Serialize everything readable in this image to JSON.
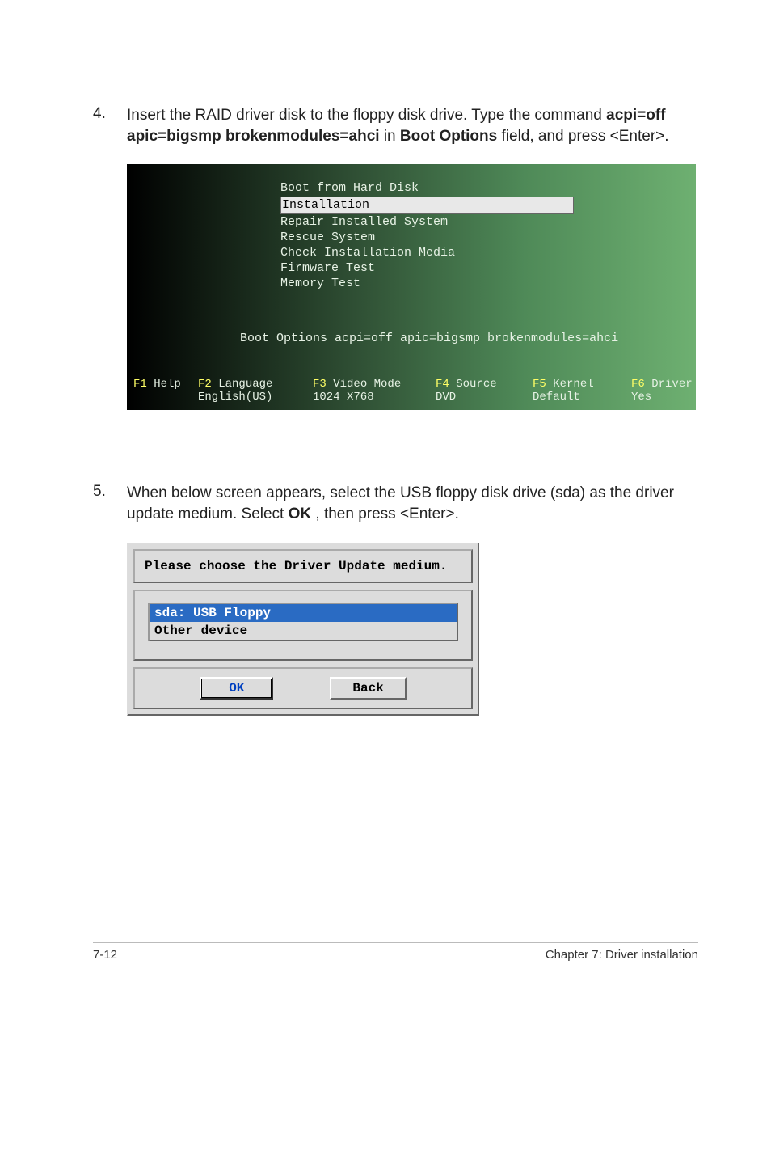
{
  "step4": {
    "num": "4.",
    "text_pre": "Insert the RAID driver disk to the floppy disk drive. Type the command ",
    "cmd": "acpi=off apic=bigsmp brokenmodules=ahci",
    "text_mid": " in ",
    "field": "Boot Options",
    "text_post": " field, and press <Enter>."
  },
  "boot": {
    "menu": [
      "Boot from Hard Disk",
      "Installation",
      "Repair Installed System",
      "Rescue System",
      "Check Installation Media",
      "Firmware Test",
      "Memory Test"
    ],
    "selected_index": 1,
    "options_line": "Boot Options acpi=off apic=bigsmp brokenmodules=ahci",
    "footer": {
      "f1": {
        "key": "F1",
        "label": "Help",
        "value": ""
      },
      "f2": {
        "key": "F2",
        "label": "Language",
        "value": "English(US)"
      },
      "f3": {
        "key": "F3",
        "label": "Video Mode",
        "value": "1024 X768"
      },
      "f4": {
        "key": "F4",
        "label": "Source",
        "value": "DVD"
      },
      "f5": {
        "key": "F5",
        "label": "Kernel",
        "value": "Default"
      },
      "f6": {
        "key": "F6",
        "label": "Driver",
        "value": "Yes"
      }
    }
  },
  "step5": {
    "num": "5.",
    "text_pre": "When below screen appears, select the USB floppy disk drive (sda) as the driver update medium. Select ",
    "ok": "OK",
    "text_post": ", then press <Enter>."
  },
  "dialog": {
    "title": "Please choose the Driver Update medium.",
    "items": [
      "sda: USB Floppy",
      "Other device"
    ],
    "selected_index": 0,
    "ok": "OK",
    "back": "Back"
  },
  "footer": {
    "page": "7-12",
    "chapter": "Chapter 7: Driver installation"
  }
}
